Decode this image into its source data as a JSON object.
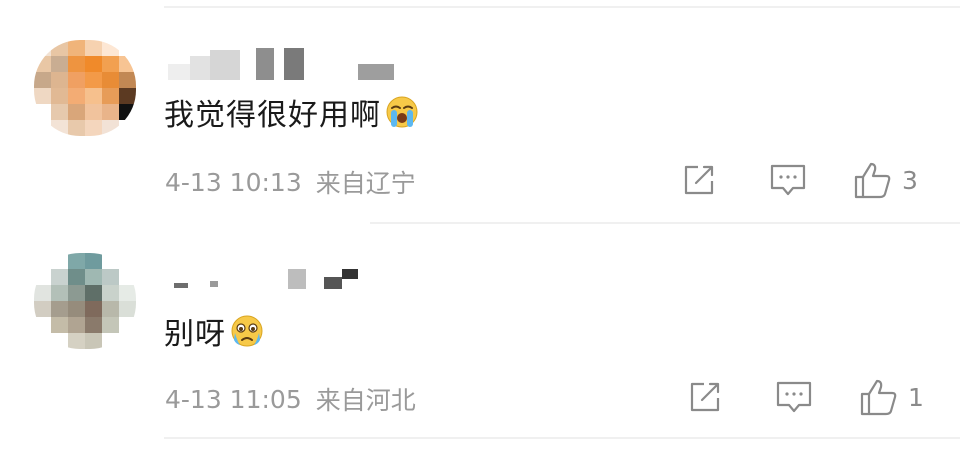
{
  "comments": [
    {
      "text": "我觉得很好用啊",
      "emoji": "loudly-crying-face",
      "date": "4-13 10:13",
      "location": "来自辽宁",
      "likes": "3",
      "icons": [
        "share-icon",
        "comment-icon",
        "thumbs-up-icon"
      ]
    },
    {
      "text": "别呀",
      "emoji": "crying-face",
      "date": "4-13 11:05",
      "location": "来自河北",
      "likes": "1",
      "icons": [
        "share-icon",
        "comment-icon",
        "thumbs-up-icon"
      ]
    }
  ],
  "colors": {
    "text": "#1a1a1a",
    "meta": "#9a9a9a",
    "icon": "#8a8a8a",
    "divider": "#f0f0f0"
  }
}
